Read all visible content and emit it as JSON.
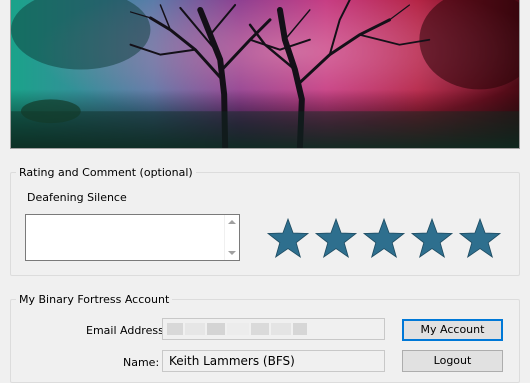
{
  "rating_section": {
    "legend": "Rating and Comment (optional)",
    "title": "Deafening Silence",
    "comment": "",
    "rating": 5,
    "max_rating": 5,
    "star_color": "#2e6f8e"
  },
  "account_section": {
    "legend": "My Binary Fortress Account",
    "email_label": "Email Address:",
    "email_value": "",
    "name_label": "Name:",
    "name_value": "Keith Lammers (BFS)",
    "my_account_button": "My Account",
    "logout_button": "Logout"
  }
}
